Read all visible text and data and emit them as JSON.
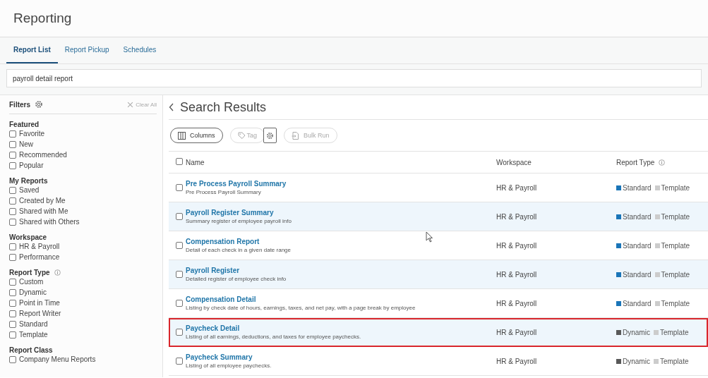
{
  "page_title": "Reporting",
  "tabs": [
    {
      "label": "Report List",
      "selected": true
    },
    {
      "label": "Report Pickup",
      "selected": false
    },
    {
      "label": "Schedules",
      "selected": false
    }
  ],
  "search": {
    "value": "payroll detail report"
  },
  "filters": {
    "title": "Filters",
    "clear": "Clear All",
    "groups": [
      {
        "title": "Featured",
        "items": [
          {
            "label": "Favorite",
            "checked": false
          },
          {
            "label": "New",
            "checked": false
          },
          {
            "label": "Recommended",
            "checked": false
          },
          {
            "label": "Popular",
            "checked": false
          }
        ]
      },
      {
        "title": "My Reports",
        "items": [
          {
            "label": "Saved",
            "checked": false
          },
          {
            "label": "Created by Me",
            "checked": false
          },
          {
            "label": "Shared with Me",
            "checked": false
          },
          {
            "label": "Shared with Others",
            "checked": false
          }
        ]
      },
      {
        "title": "Workspace",
        "items": [
          {
            "label": "HR & Payroll",
            "checked": false
          },
          {
            "label": "Performance",
            "checked": false
          }
        ]
      },
      {
        "title": "Report Type",
        "info": true,
        "items": [
          {
            "label": "Custom",
            "checked": false
          },
          {
            "label": "Dynamic",
            "checked": false
          },
          {
            "label": "Point in Time",
            "checked": false
          },
          {
            "label": "Report Writer",
            "checked": false
          },
          {
            "label": "Standard",
            "checked": false
          },
          {
            "label": "Template",
            "checked": false
          }
        ]
      },
      {
        "title": "Report Class",
        "items": [
          {
            "label": "Company Menu Reports",
            "checked": false
          }
        ]
      }
    ]
  },
  "results": {
    "title": "Search Results",
    "toolbar": [
      {
        "kind": "columns",
        "label": "Columns",
        "disabled": false
      },
      {
        "kind": "tag",
        "label": "Tag",
        "disabled": true
      },
      {
        "kind": "gear",
        "disabled": false
      },
      {
        "kind": "run",
        "label": "Bulk Run",
        "disabled": true
      }
    ],
    "select_all_checked": false,
    "columns": [
      {
        "label": "Name"
      },
      {
        "label": "Workspace"
      },
      {
        "label": "Report Type",
        "info": true
      }
    ],
    "rows": [
      {
        "name": "Pre Process Payroll Summary",
        "description": "Pre Process Payroll Summary",
        "workspace": "HR & Payroll",
        "checked": false,
        "highlighted": false,
        "types": [
          {
            "label": "Standard",
            "color": "#1a75b8"
          },
          {
            "label": "Template",
            "color": "#cccccc"
          }
        ]
      },
      {
        "name": "Payroll Register Summary",
        "description": "Summary register of employee payroll info",
        "workspace": "HR & Payroll",
        "checked": false,
        "highlighted": false,
        "types": [
          {
            "label": "Standard",
            "color": "#1a75b8"
          },
          {
            "label": "Template",
            "color": "#cccccc"
          }
        ]
      },
      {
        "name": "Compensation Report",
        "description": "Detail of each check in a given date range",
        "workspace": "HR & Payroll",
        "checked": false,
        "highlighted": false,
        "types": [
          {
            "label": "Standard",
            "color": "#1a75b8"
          },
          {
            "label": "Template",
            "color": "#cccccc"
          }
        ]
      },
      {
        "name": "Payroll Register",
        "description": "Detailed register of employee check info",
        "workspace": "HR & Payroll",
        "checked": false,
        "highlighted": false,
        "types": [
          {
            "label": "Standard",
            "color": "#1a75b8"
          },
          {
            "label": "Template",
            "color": "#cccccc"
          }
        ]
      },
      {
        "name": "Compensation Detail",
        "description": "Listing by check date of hours, earnings, taxes, and net pay, with a page break by employee",
        "workspace": "HR & Payroll",
        "checked": false,
        "highlighted": false,
        "types": [
          {
            "label": "Standard",
            "color": "#1a75b8"
          },
          {
            "label": "Template",
            "color": "#cccccc"
          }
        ]
      },
      {
        "name": "Paycheck Detail",
        "description": "Listing of all earnings, deductions, and taxes for employee paychecks.",
        "workspace": "HR & Payroll",
        "checked": false,
        "highlighted": true,
        "types": [
          {
            "label": "Dynamic",
            "color": "#595959"
          },
          {
            "label": "Template",
            "color": "#cccccc"
          }
        ]
      },
      {
        "name": "Paycheck Summary",
        "description": "Listing of all employee paychecks.",
        "workspace": "HR & Payroll",
        "checked": false,
        "highlighted": false,
        "types": [
          {
            "label": "Dynamic",
            "color": "#595959"
          },
          {
            "label": "Template",
            "color": "#cccccc"
          }
        ]
      }
    ]
  }
}
